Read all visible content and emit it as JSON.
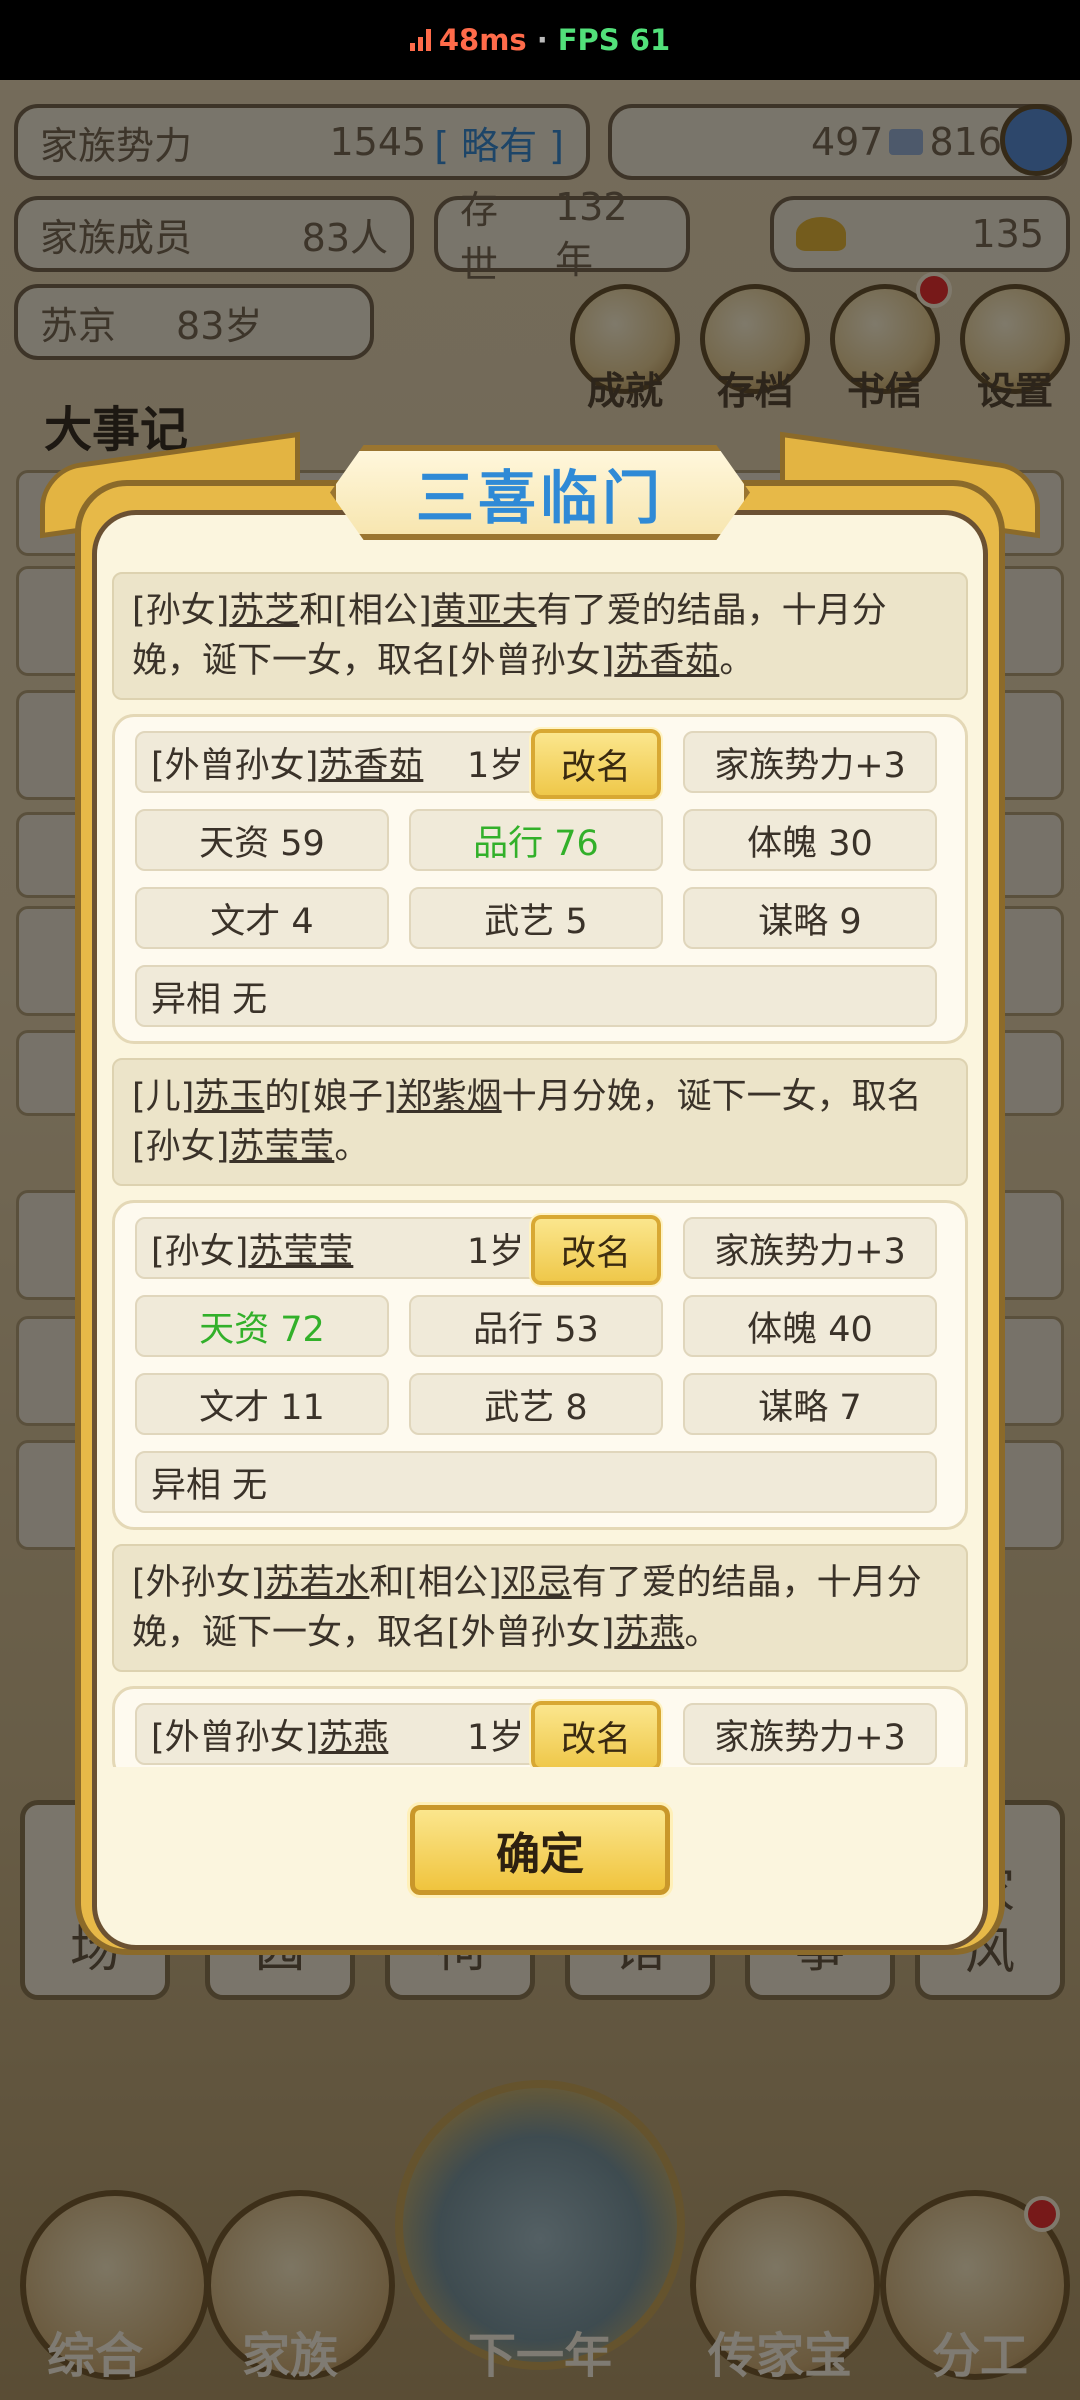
{
  "status_bar": {
    "ping": "48ms",
    "separator": "·",
    "fps": "FPS 61"
  },
  "background": {
    "family_power": {
      "label": "家族势力",
      "value": "1545",
      "rank": "[ 略有 ]"
    },
    "currency": {
      "silver": "497",
      "coins": "816"
    },
    "members": {
      "label": "家族成员",
      "value": "83人"
    },
    "existence": {
      "label": "存世",
      "value": "132年"
    },
    "gold": "135",
    "leader": {
      "name": "苏京",
      "age": "83岁"
    },
    "menu_buttons": [
      "成就",
      "存档",
      "书信",
      "设置"
    ],
    "events_title": "大事记",
    "tiles": [
      "场",
      "园",
      "祠",
      "馆",
      "事",
      "家\n风"
    ],
    "bottom_nav": [
      "综合",
      "家族",
      "下一年",
      "传家宝",
      "分工"
    ]
  },
  "dialog": {
    "title": "三喜临门",
    "confirm_label": "确定",
    "events": [
      {
        "segments": [
          {
            "text": "[孙女]",
            "u": false
          },
          {
            "text": "苏芝",
            "u": true
          },
          {
            "text": "和[相公]",
            "u": false
          },
          {
            "text": "黄亚夫",
            "u": true
          },
          {
            "text": "有了爱的结晶，十月分娩，诞下一女，取名[外曾孙女]",
            "u": false
          },
          {
            "text": "苏香茹",
            "u": true
          },
          {
            "text": "。",
            "u": false
          }
        ],
        "child": {
          "relation": "[外曾孙女]",
          "name": "苏香茹",
          "age": "1岁",
          "rename": "改名",
          "bonus": "家族势力+3",
          "stats": [
            {
              "text": "天资 59",
              "green": false
            },
            {
              "text": "品行 76",
              "green": true
            },
            {
              "text": "体魄 30",
              "green": false
            },
            {
              "text": "文才 4",
              "green": false
            },
            {
              "text": "武艺 5",
              "green": false
            },
            {
              "text": "谋略 9",
              "green": false
            }
          ],
          "trait": "异相 无"
        }
      },
      {
        "segments": [
          {
            "text": "[儿]",
            "u": false
          },
          {
            "text": "苏玉",
            "u": true
          },
          {
            "text": "的[娘子]",
            "u": false
          },
          {
            "text": "郑紫烟",
            "u": true
          },
          {
            "text": "十月分娩，诞下一女，取名[孙女]",
            "u": false
          },
          {
            "text": "苏莹莹",
            "u": true
          },
          {
            "text": "。",
            "u": false
          }
        ],
        "child": {
          "relation": "[孙女]",
          "name": "苏莹莹",
          "age": "1岁",
          "rename": "改名",
          "bonus": "家族势力+3",
          "stats": [
            {
              "text": "天资 72",
              "green": true
            },
            {
              "text": "品行 53",
              "green": false
            },
            {
              "text": "体魄 40",
              "green": false
            },
            {
              "text": "文才 11",
              "green": false
            },
            {
              "text": "武艺 8",
              "green": false
            },
            {
              "text": "谋略 7",
              "green": false
            }
          ],
          "trait": "异相 无"
        }
      },
      {
        "segments": [
          {
            "text": "[外孙女]",
            "u": false
          },
          {
            "text": "苏若水",
            "u": true
          },
          {
            "text": "和[相公]",
            "u": false
          },
          {
            "text": "邓忌",
            "u": true
          },
          {
            "text": "有了爱的结晶，十月分娩，诞下一女，取名[外曾孙女]",
            "u": false
          },
          {
            "text": "苏燕",
            "u": true
          },
          {
            "text": "。",
            "u": false
          }
        ],
        "child": {
          "relation": "[外曾孙女]",
          "name": "苏燕",
          "age": "1岁",
          "rename": "改名",
          "bonus": "家族势力+3",
          "stats": [],
          "trait": ""
        }
      }
    ]
  }
}
